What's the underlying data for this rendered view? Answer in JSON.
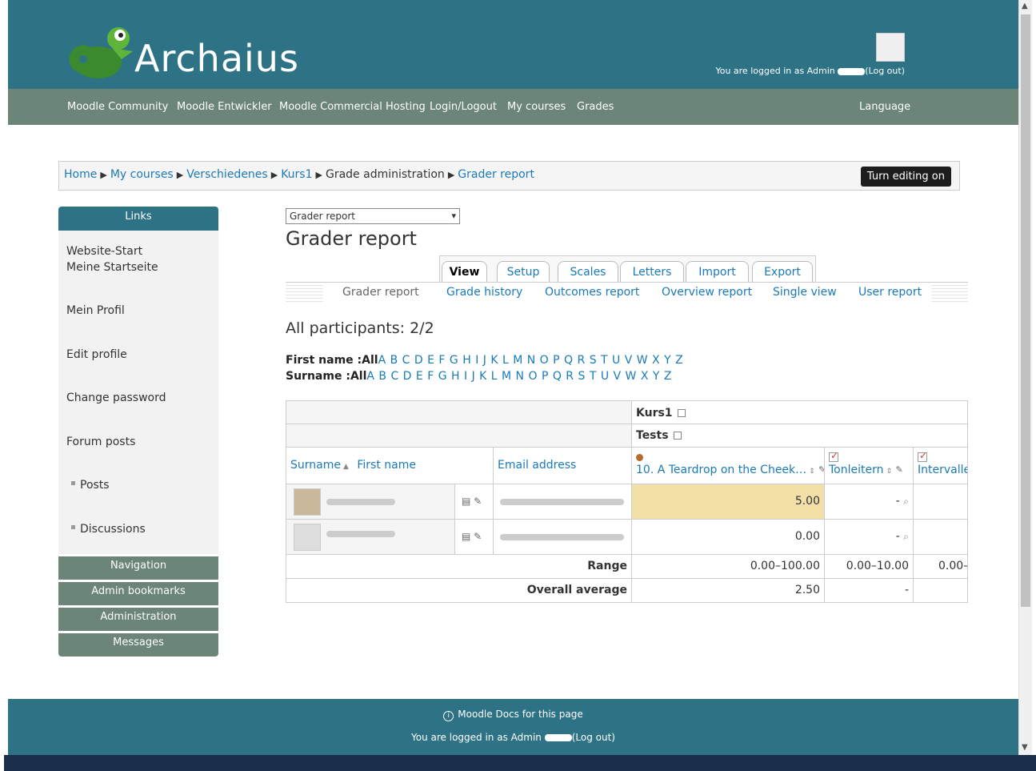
{
  "header": {
    "logo_text": "Archaius",
    "login_prefix": "You are logged in as Admin",
    "logout_label": "(Log out)"
  },
  "nav": {
    "items": [
      "Moodle Community",
      "Moodle Entwickler",
      "Moodle Commercial Hosting",
      "Login/Logout",
      "My courses",
      "Grades"
    ],
    "language": "Language"
  },
  "breadcrumb": {
    "items": [
      "Home",
      "My courses",
      "Verschiedenes",
      "Kurs1",
      "Grade administration",
      "Grader report"
    ],
    "edit_button": "Turn editing on"
  },
  "sidebar": {
    "links_title": "Links",
    "links": [
      "Website-Start",
      "Meine Startseite",
      "Mein Profil",
      "Edit profile",
      "Change password",
      "Forum posts",
      "Posts",
      "Discussions"
    ],
    "blocks": [
      "Navigation",
      "Admin bookmarks",
      "Administration",
      "Messages"
    ]
  },
  "main": {
    "select_value": "Grader report",
    "title": "Grader report",
    "tabs": [
      "View",
      "Setup",
      "Scales",
      "Letters",
      "Import",
      "Export"
    ],
    "subtabs": [
      "Grader report",
      "Grade history",
      "Outcomes report",
      "Overview report",
      "Single view",
      "User report"
    ],
    "participants": "All participants: 2/2",
    "firstname_label": "First name :",
    "surname_label": "Surname :",
    "all_label": "All",
    "letters": "A B C D E F G H I J K L M N O P Q R S T U V W X Y Z"
  },
  "grid": {
    "course": "Kurs1",
    "category": "Tests",
    "col_surname": "Surname",
    "col_firstname": "First name",
    "col_email": "Email address",
    "items": [
      "10. A Teardrop on the Cheek…",
      "Tonleitern",
      "Intervalle"
    ],
    "rows": [
      {
        "grades": [
          "5.00",
          "-",
          ""
        ]
      },
      {
        "grades": [
          "0.00",
          "-",
          ""
        ]
      }
    ],
    "range_label": "Range",
    "ranges": [
      "0.00–100.00",
      "0.00–10.00",
      "0.00–"
    ],
    "average_label": "Overall average",
    "averages": [
      "2.50",
      "-",
      ""
    ]
  },
  "footer": {
    "docs_link": "Moodle Docs for this page",
    "login_prefix": "You are logged in as Admin",
    "logout_label": "(Log out)"
  },
  "colors": {
    "header": "#2e7286",
    "navbar": "#6b8578",
    "highlight": "#f3dfa8",
    "link": "#1a7ab8"
  }
}
